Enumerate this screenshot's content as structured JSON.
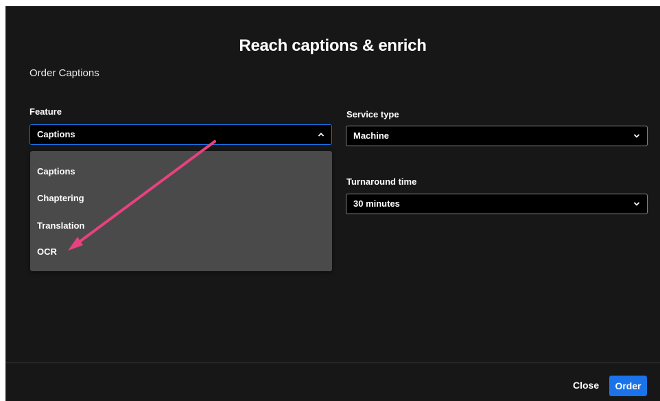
{
  "modal": {
    "title": "Reach captions & enrich",
    "section_title": "Order Captions"
  },
  "feature": {
    "label": "Feature",
    "selected": "Captions",
    "options": [
      "Captions",
      "Chaptering",
      "Translation",
      "OCR"
    ],
    "is_open": true
  },
  "service_type": {
    "label": "Service type",
    "selected": "Machine"
  },
  "turnaround": {
    "label": "Turnaround time",
    "selected": "30 minutes"
  },
  "footer": {
    "close_label": "Close",
    "order_label": "Order"
  },
  "colors": {
    "modal_bg": "#171717",
    "dropdown_bg": "#4a4a4a",
    "accent": "#1a73e8",
    "annotation_arrow": "#e8417f"
  }
}
